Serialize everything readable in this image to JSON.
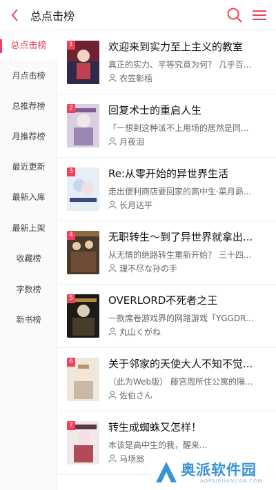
{
  "header": {
    "title": "总点击榜"
  },
  "sidebar": {
    "items": [
      {
        "label": "总点击榜",
        "active": true
      },
      {
        "label": "月点击榜"
      },
      {
        "label": "总推荐榜"
      },
      {
        "label": "月推荐榜"
      },
      {
        "label": "最近更新"
      },
      {
        "label": "最新入库"
      },
      {
        "label": "最新上架"
      },
      {
        "label": "收藏榜"
      },
      {
        "label": "字数榜"
      },
      {
        "label": "新书榜"
      }
    ]
  },
  "books": [
    {
      "rank": "1",
      "title": "欢迎来到实力至上主义的教室",
      "desc": "真正的实力、平等究竟为何？ 几乎百...",
      "author": "衣笠彰梧"
    },
    {
      "rank": "2",
      "title": "回复术士的重启人生",
      "desc": "「一想到这种派不上用场的居然是同...",
      "author": "月夜泪"
    },
    {
      "rank": "3",
      "title": "Re:从零开始的异世界生活",
      "desc": "走出便利商店要回家的高中生·菜月昴...",
      "author": "长月达平"
    },
    {
      "rank": "4",
      "title": "无职转生～到了异世界就拿出...",
      "desc": "从无情的绝路转生重新开始？ 三十四...",
      "author": "理不尽な孙の手"
    },
    {
      "rank": "5",
      "title": "OVERLORD不死者之王",
      "desc": "一款席卷游戏界的网路游戏「YGGDR...",
      "author": "丸山くがね"
    },
    {
      "rank": "6",
      "title": "关于邻家的天使大人不知不觉...",
      "desc": "（此为Web版） 藤宫周所住公寓的隔...",
      "author": "佐伯さん"
    },
    {
      "rank": "7",
      "title": "转生成蜘蛛又怎样！",
      "desc": "本该是高中生的我，醒来...",
      "author": "马场翁"
    }
  ],
  "watermark": {
    "text": "奥派软件园",
    "sub": "AOPAIRUANJIAN.COM"
  },
  "colors": {
    "accent": "#f0405a",
    "watermark": "#3a93d6"
  },
  "icons": {
    "back": "chevron-left-icon",
    "search": "search-icon",
    "menu": "hamburger-menu-icon",
    "author": "person-icon"
  }
}
